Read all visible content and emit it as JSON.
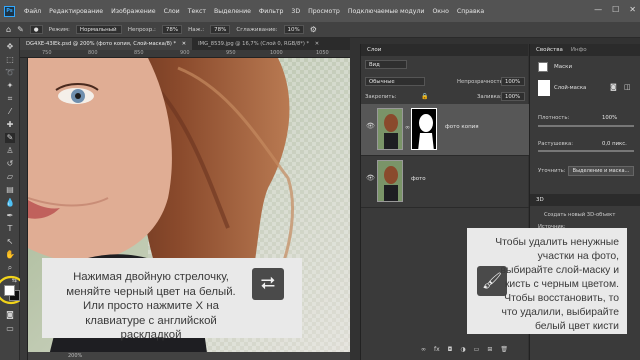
{
  "menubar": {
    "app_logo": "Ps",
    "items": [
      "Файл",
      "Редактирование",
      "Изображение",
      "Слои",
      "Текст",
      "Выделение",
      "Фильтр",
      "3D",
      "Просмотр",
      "Подключаемые модули",
      "Окно",
      "Справка"
    ]
  },
  "options_bar": {
    "mode_label": "Режим:",
    "mode_value": "Нормальный",
    "opacity_label": "Непрозр.:",
    "opacity_value": "78%",
    "pressure_label": "Наж.:",
    "pressure_value": "78%",
    "smoothing_label": "Сглаживание:",
    "smoothing_value": "10%"
  },
  "document_tabs": [
    {
      "label": "DG4XE-43lEk.psd @ 200% (фото копия, Слой-маска/8) *"
    },
    {
      "label": "IMG_8539.jpg @ 16,7% (Слой 0, RGB/8*) *"
    }
  ],
  "ruler": {
    "marks": [
      "750",
      "800",
      "850",
      "900",
      "950",
      "1000",
      "1050"
    ]
  },
  "hint_left": {
    "text": "Нажимая двойную стрелочку, меняйте черный цвет на белый. Или просто нажмите X на клавиатуре с английской раскладкой",
    "icon": "swap-arrows-icon"
  },
  "hint_right": {
    "text": "Чтобы удалить ненужные участки на фото, выбирайте слой-маску и кисть с черным цветом. Чтобы восстановить, то что удалили, выбирайте белый цвет кисти",
    "icon": "brush-icon"
  },
  "layers_panel": {
    "title": "Слои",
    "filter_label": "Вид",
    "blend_mode": "Обычные",
    "opacity_label": "Непрозрачность:",
    "opacity_value": "100%",
    "lock_label": "Закрепить:",
    "fill_label": "Заливка:",
    "fill_value": "100%",
    "layers": [
      {
        "name": "фото копия",
        "selected": true,
        "has_mask": true
      },
      {
        "name": "фото",
        "selected": false,
        "has_mask": false
      }
    ]
  },
  "properties_panel": {
    "tabs": [
      "Свойства",
      "Инфо"
    ],
    "section": "Маски",
    "mask_label": "Слой-маска",
    "density_label": "Плотность:",
    "density_value": "100%",
    "feather_label": "Растушевка:",
    "feather_value": "0,0 пикс.",
    "refine_label": "Уточнить:",
    "refine_button": "Выделение и маска...",
    "panel_3d_title": "3D",
    "create_3d_label": "Создать новый 3D-объект",
    "source_label": "Источник:"
  },
  "status_bar": {
    "zoom": "200%"
  },
  "colors": {
    "menubar": "#535353",
    "panel": "#3a3a3a",
    "hint_bg": "#e9e9e9",
    "annotation_ring": "#f2d41a"
  }
}
